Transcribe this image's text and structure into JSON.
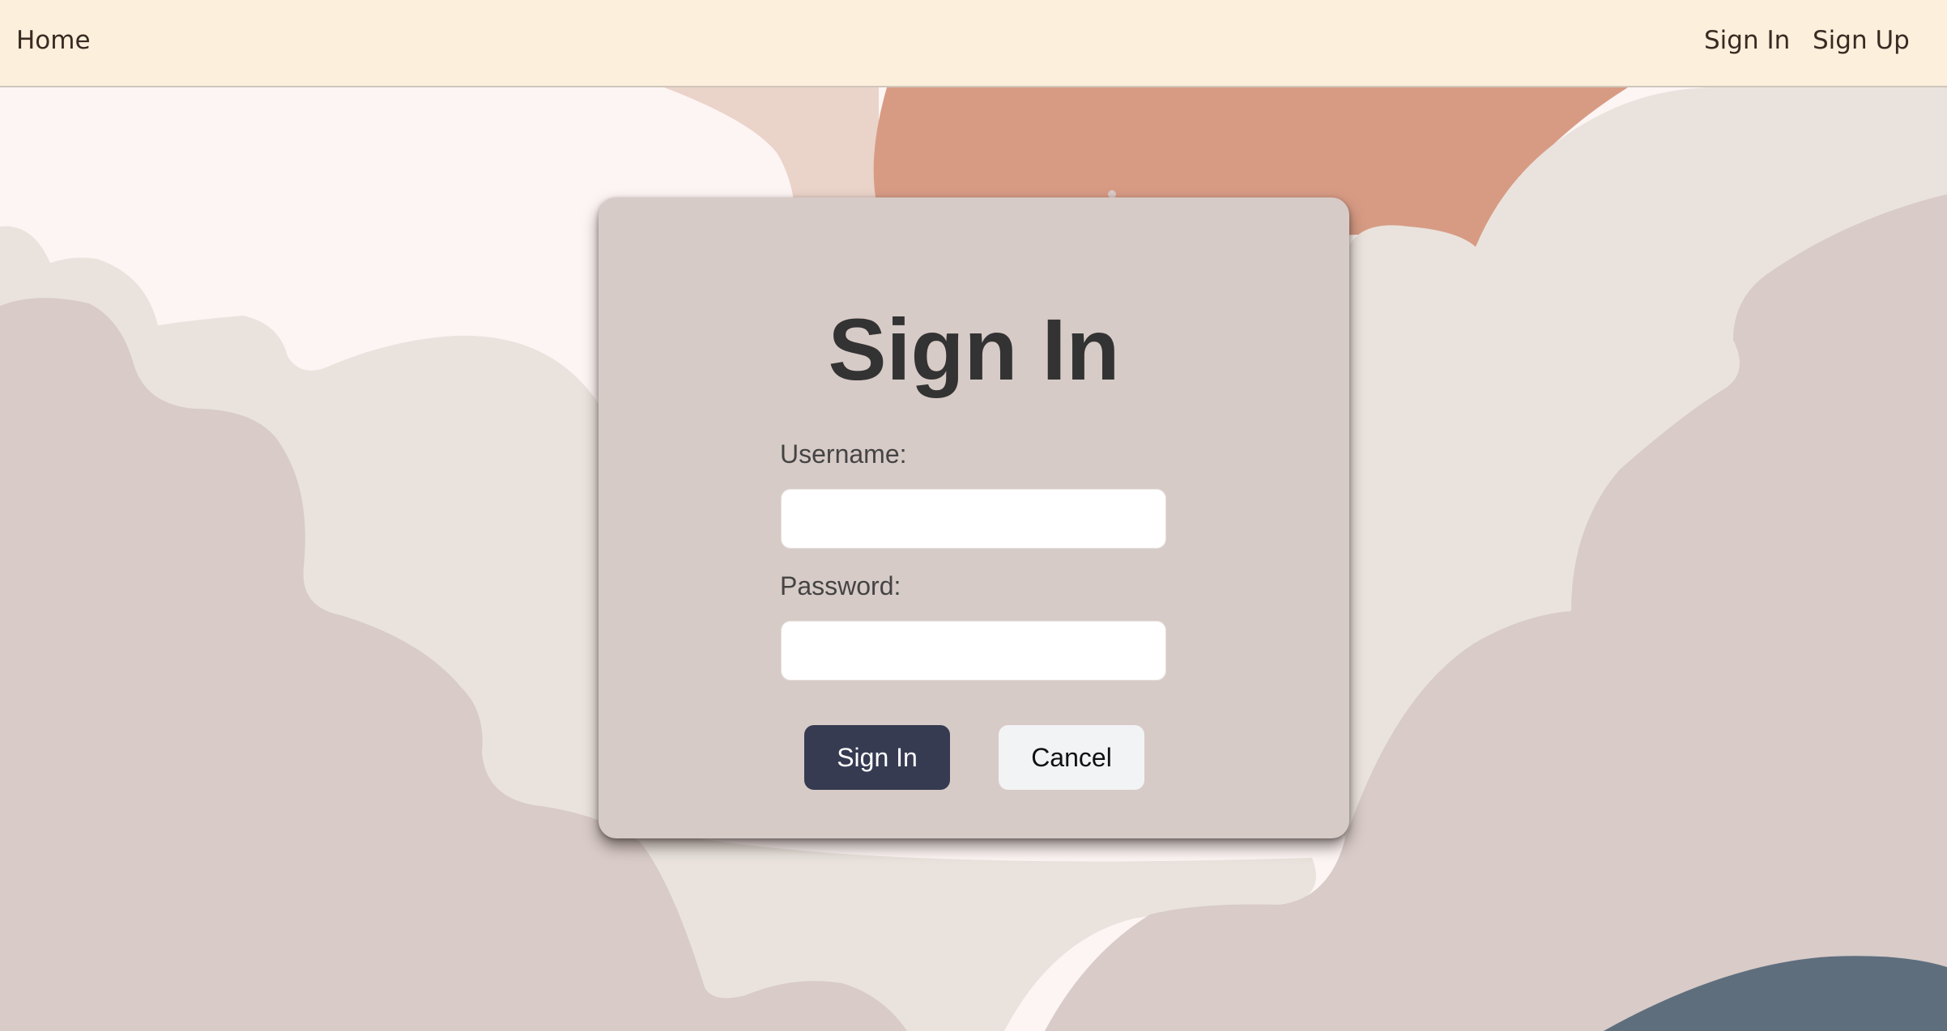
{
  "navbar": {
    "home_label": "Home",
    "signin_label": "Sign In",
    "signup_label": "Sign Up"
  },
  "form": {
    "title": "Sign In",
    "username_label": "Username:",
    "username_value": "",
    "password_label": "Password:",
    "password_value": "",
    "submit_label": "Sign In",
    "cancel_label": "Cancel"
  },
  "colors": {
    "navbar_background": "#fcefdc",
    "card_background": "#d7cbc7",
    "primary_button": "#363b51",
    "secondary_button": "#f2f3f5",
    "background_pink": "#fdf5f4",
    "background_peach": "#ead3c9",
    "background_terracotta": "#d79b84",
    "background_cream": "#eae3dd",
    "background_mauve": "#d8cbc8",
    "background_slate": "#5e6e7d"
  }
}
